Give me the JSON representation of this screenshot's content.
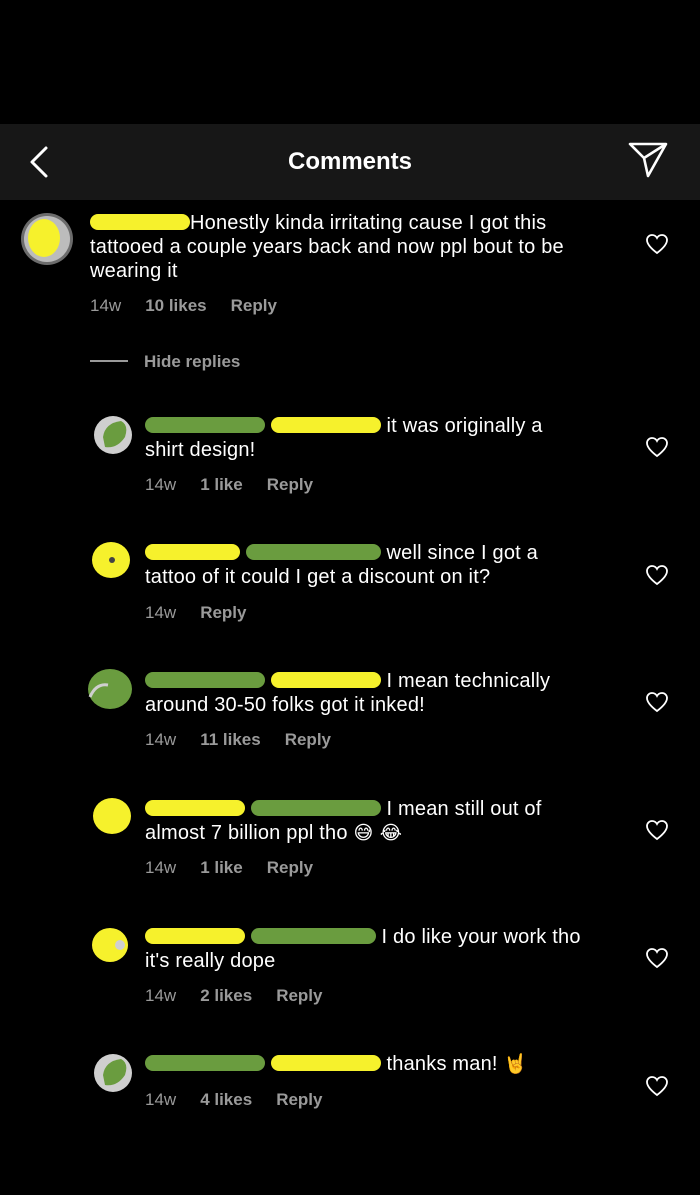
{
  "header": {
    "title": "Comments"
  },
  "hide_replies": "Hide replies",
  "comments": [
    {
      "text": "Honestly kinda irritating cause I got this",
      "text2": "tattooed a couple years back and now ppl bout to be",
      "text3": "wearing it",
      "age": "14w",
      "likes": "10 likes",
      "reply": "Reply"
    },
    {
      "text": "it was originally a",
      "text2": "shirt design!",
      "age": "14w",
      "likes": "1 like",
      "reply": "Reply"
    },
    {
      "text": "well since I got a",
      "text2": "tattoo of it could I get a discount on it?",
      "age": "14w",
      "reply": "Reply"
    },
    {
      "text": "I mean technically",
      "text2": "around 30-50 folks got it inked!",
      "age": "14w",
      "likes": "11 likes",
      "reply": "Reply"
    },
    {
      "text": "I mean still out of",
      "text2": "almost 7 billion ppl tho",
      "emoji": "😅 😂",
      "age": "14w",
      "likes": "1 like",
      "reply": "Reply"
    },
    {
      "text": "I do like your work tho",
      "text2": "it's really dope",
      "age": "14w",
      "likes": "2 likes",
      "reply": "Reply"
    },
    {
      "text": "thanks man!",
      "emoji": "🤘",
      "age": "14w",
      "likes": "4 likes",
      "reply": "Reply"
    }
  ],
  "colors": {
    "redact_yellow": "#f6f12c",
    "redact_green": "#6a9c3f",
    "header_bg": "#171717",
    "meta": "#9a9a9a"
  }
}
